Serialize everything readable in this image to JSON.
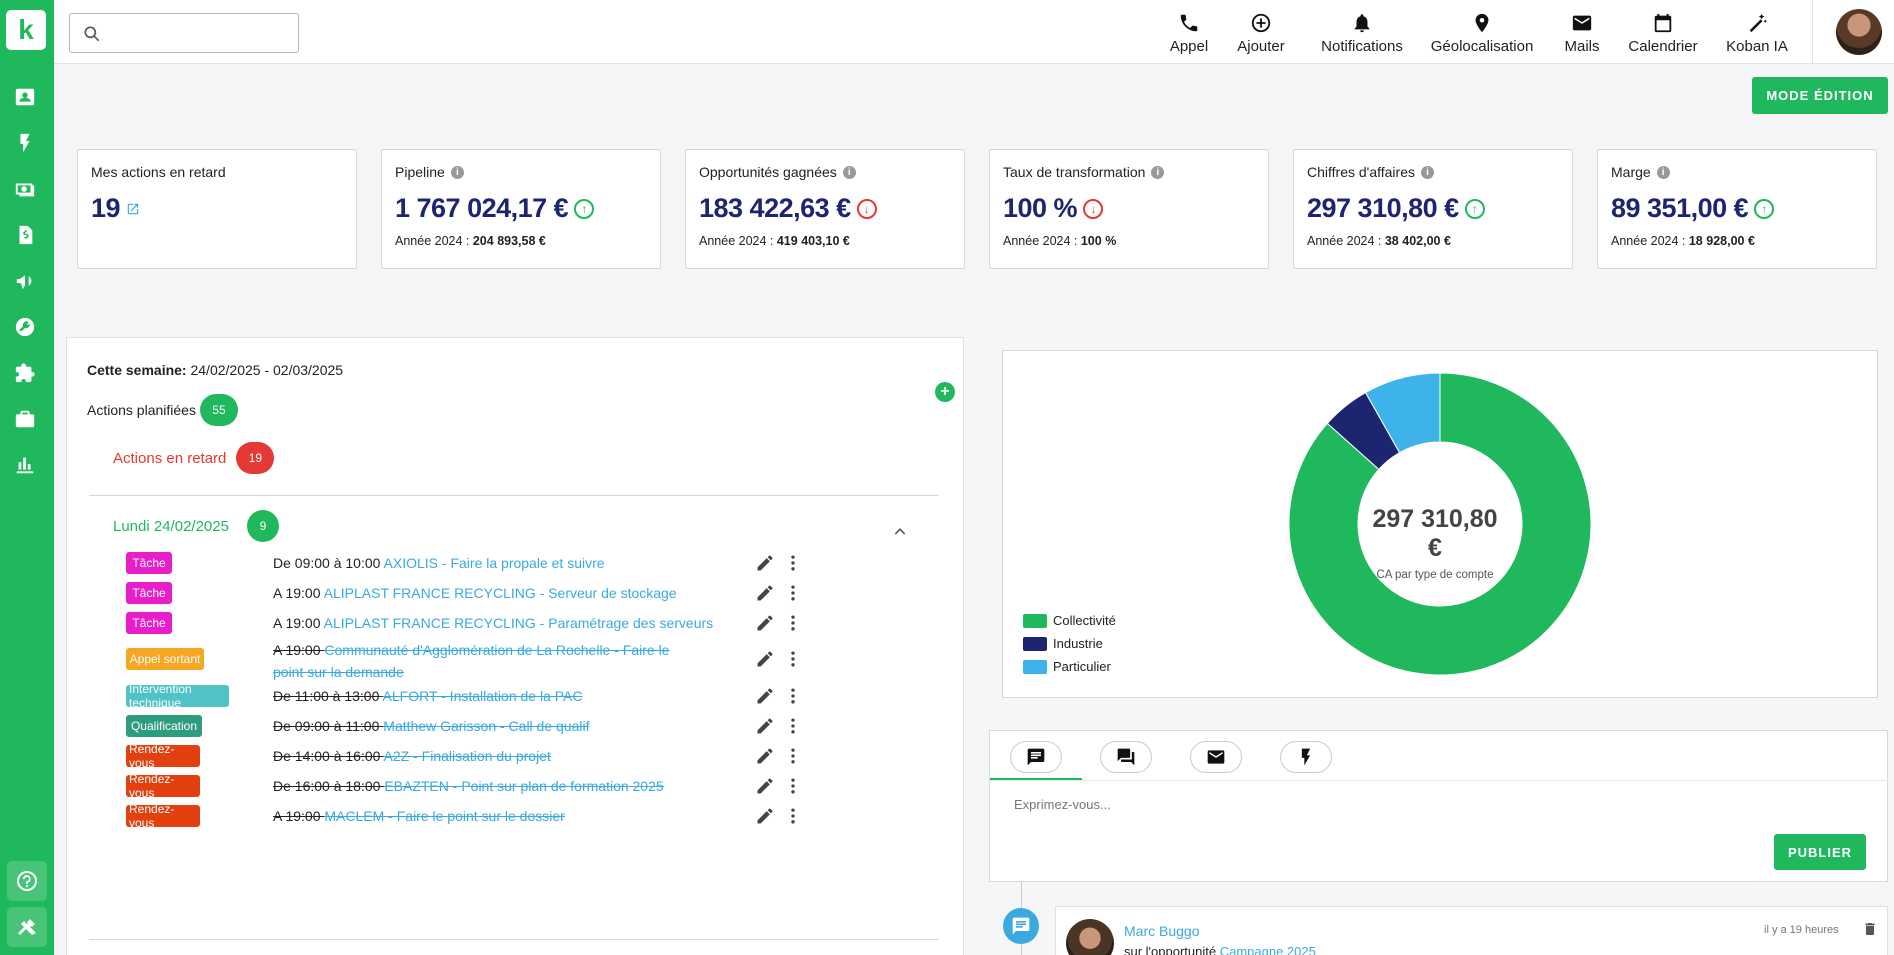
{
  "sidebar": {
    "logo": "k",
    "icons": [
      "contacts-icon",
      "bolt-icon",
      "money-icon",
      "invoice-icon",
      "megaphone-icon",
      "wrench-icon",
      "puzzle-icon",
      "briefcase-icon",
      "stats-icon"
    ],
    "bottom_icons": [
      "help-icon",
      "tools-icon"
    ]
  },
  "topbar": {
    "search_placeholder": "",
    "nav": [
      {
        "label": "Appel",
        "icon": "phone-icon"
      },
      {
        "label": "Ajouter",
        "icon": "add-circle-icon"
      },
      {
        "label": "Notifications",
        "icon": "bell-icon"
      },
      {
        "label": "Géolocalisation",
        "icon": "location-pin-icon"
      },
      {
        "label": "Mails",
        "icon": "mail-icon"
      },
      {
        "label": "Calendrier",
        "icon": "calendar-icon"
      },
      {
        "label": "Koban IA",
        "icon": "magic-wand-icon"
      }
    ]
  },
  "mode_edition": "MODE ÉDITION",
  "kpis": [
    {
      "title": "Mes actions en retard",
      "value": "19",
      "info": false
    },
    {
      "title": "Pipeline",
      "value": "1 767 024,17 €",
      "trend": "up",
      "sub_label": "Année 2024 : ",
      "sub_value": "204 893,58 €"
    },
    {
      "title": "Opportunités gagnées",
      "value": "183 422,63 €",
      "trend": "down",
      "sub_label": "Année 2024 : ",
      "sub_value": "419 403,10 €"
    },
    {
      "title": "Taux de transformation",
      "value": "100 %",
      "trend": "down",
      "sub_label": "Année 2024 : ",
      "sub_value": "100 %"
    },
    {
      "title": "Chiffres d'affaires",
      "value": "297 310,80 €",
      "trend": "up",
      "sub_label": "Année 2024 : ",
      "sub_value": "38 402,00 €"
    },
    {
      "title": "Marge",
      "value": "89 351,00 €",
      "trend": "up",
      "sub_label": "Année 2024 : ",
      "sub_value": "18 928,00 €"
    }
  ],
  "actions": {
    "week_label": "Cette semaine:",
    "week_range": "24/02/2025 - 02/03/2025",
    "planned_label": "Actions planifiées",
    "planned_count": "55",
    "late_label": "Actions en retard",
    "late_count": "19",
    "day_label": "Lundi 24/02/2025",
    "day_count": "9",
    "items": [
      {
        "tag": "Tâche",
        "tag_color": "#e91ecb",
        "time": "De 09:00 à 10:00",
        "title": "AXIOLIS - Faire la propale et suivre",
        "done": false
      },
      {
        "tag": "Tâche",
        "tag_color": "#e91ecb",
        "time": "A 19:00",
        "title": "ALIPLAST FRANCE RECYCLING - Serveur de stockage",
        "done": false
      },
      {
        "tag": "Tâche",
        "tag_color": "#e91ecb",
        "time": "A 19:00",
        "title": "ALIPLAST FRANCE RECYCLING - Paramétrage des serveurs",
        "done": false
      },
      {
        "tag": "Appel sortant",
        "tag_color": "#f5a623",
        "time": "A 19:00",
        "title": "Communauté d'Agglomération de La Rochelle - Faire le point sur la demande",
        "done": true
      },
      {
        "tag": "Intervention technique",
        "tag_color": "#4fc3c8",
        "time": "De 11:00 à 13:00",
        "title": "ALFORT - Installation de la PAC",
        "done": true
      },
      {
        "tag": "Qualification",
        "tag_color": "#2e9c7e",
        "time": "De 09:00 à 11:00",
        "title": "Matthew Garisson - Call de qualif",
        "done": true
      },
      {
        "tag": "Rendez-vous",
        "tag_color": "#e2410f",
        "time": "De 14:00 à 16:00",
        "title": "A2Z - Finalisation du projet",
        "done": true
      },
      {
        "tag": "Rendez-vous",
        "tag_color": "#e2410f",
        "time": "De 16:00 à 18:00",
        "title": "EBAZTEN - Point sur plan de formation 2025",
        "done": true
      },
      {
        "tag": "Rendez-vous",
        "tag_color": "#e2410f",
        "time": "A 19:00",
        "title": "MACLEM - Faire le point sur le dossier",
        "done": true
      }
    ]
  },
  "chart_data": {
    "type": "pie",
    "categories": [
      "Collectivité",
      "Industrie",
      "Particulier"
    ],
    "values": [
      86.6,
      5.2,
      8.2
    ],
    "colors": [
      "#20b85c",
      "#1e2570",
      "#3db3ea"
    ],
    "center_value": "297 310,80 €",
    "center_label": "CA par type de compte",
    "legend_position": "bottom-left"
  },
  "post": {
    "tabs": [
      "comment-icon",
      "chat-icon",
      "mail-icon",
      "bolt-icon"
    ],
    "placeholder": "Exprimez-vous...",
    "publish": "PUBLIER"
  },
  "feed": {
    "author": "Marc Buggo",
    "sub_prefix": "sur l'opportunité ",
    "sub_link": "Campagne 2025",
    "time": "il y a 19 heures"
  }
}
